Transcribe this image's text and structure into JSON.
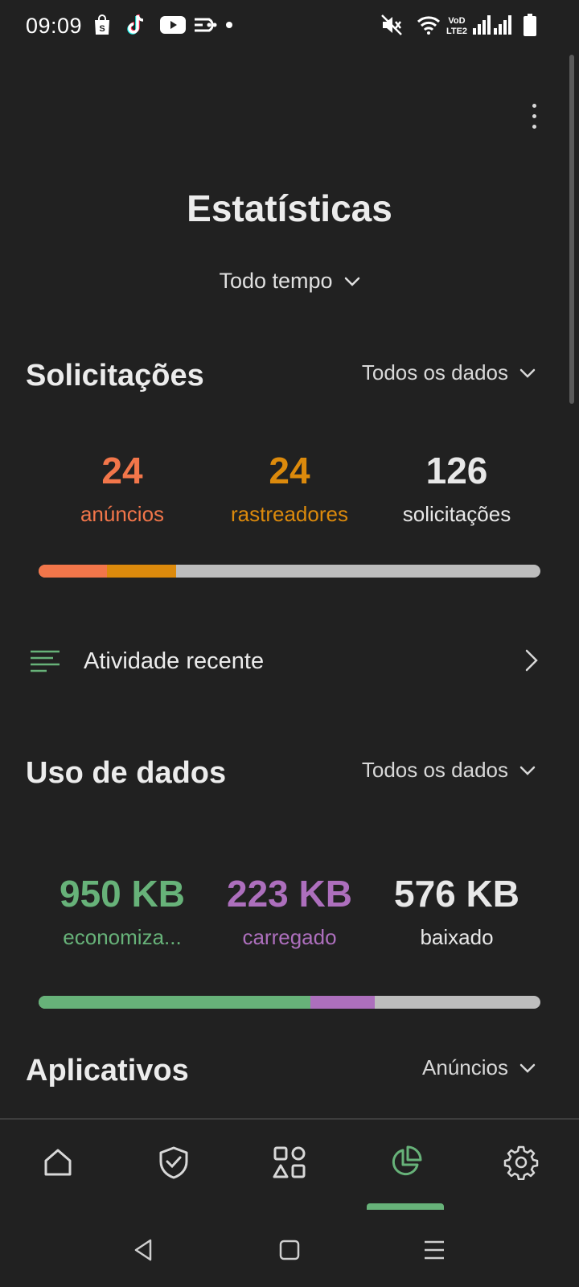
{
  "status_bar": {
    "time": "09:09",
    "left_icons": [
      "shopping-bag-icon",
      "tiktok-icon",
      "youtube-icon",
      "voicemail-icon",
      "dot-icon"
    ],
    "right_icons": [
      "mute-icon",
      "wifi-icon",
      "volte-icon",
      "signal-icon",
      "signal-icon",
      "battery-icon"
    ]
  },
  "header": {
    "title": "Estatísticas",
    "time_filter": "Todo tempo"
  },
  "requests": {
    "title": "Solicitações",
    "filter": "Todos os dados",
    "stats": [
      {
        "value": "24",
        "label": "anúncios",
        "color": "#f2764a"
      },
      {
        "value": "24",
        "label": "rastreadores",
        "color": "#dc8a0c"
      },
      {
        "value": "126",
        "label": "solicitações",
        "color": "#e8e8e8"
      }
    ],
    "bar": [
      {
        "name": "anúncios",
        "fraction": 0.137,
        "color": "#f2764a"
      },
      {
        "name": "rastreadores",
        "fraction": 0.137,
        "color": "#dc8a0c"
      }
    ],
    "bar_track_color": "#bdbdbd"
  },
  "recent_activity": {
    "label": "Atividade recente",
    "icon": "list-icon"
  },
  "data_usage": {
    "title": "Uso de dados",
    "filter": "Todos os dados",
    "stats": [
      {
        "value": "950 KB",
        "label": "economiza...",
        "color": "#67b279"
      },
      {
        "value": "223 KB",
        "label": "carregado",
        "color": "#ad6fbd"
      },
      {
        "value": "576 KB",
        "label": "baixado",
        "color": "#e8e8e8"
      }
    ],
    "bar": [
      {
        "name": "economizado",
        "fraction": 0.542,
        "color": "#67b279"
      },
      {
        "name": "carregado",
        "fraction": 0.128,
        "color": "#ad6fbd"
      }
    ]
  },
  "apps": {
    "title": "Aplicativos",
    "filter": "Anúncios"
  },
  "bottom_nav": {
    "items": [
      "home-icon",
      "shield-check-icon",
      "apps-grid-icon",
      "pie-chart-icon",
      "settings-gear-icon"
    ],
    "active_index": 3,
    "active_color": "#67b279"
  },
  "system_nav": [
    "back-icon",
    "home-square-icon",
    "recents-menu-icon"
  ]
}
